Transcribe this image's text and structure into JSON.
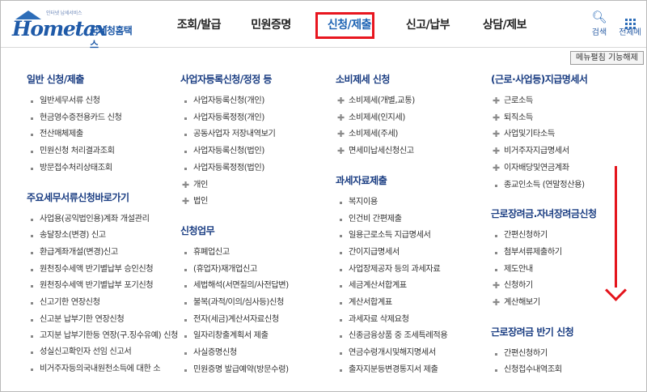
{
  "header": {
    "logo_tagline": "인터넷 납세서비스",
    "logo_word": "Hometax",
    "logo_sub": "국세청홈택스",
    "menu": [
      "조회/발급",
      "민원증명",
      "신청/제출",
      "신고/납부",
      "상담/제보"
    ],
    "active_menu_index": 2,
    "search_label": "검색",
    "all_menu_label": "전체메",
    "highlight_color": "#e8161f",
    "brand_color": "#1f5aa8"
  },
  "pin_button_label": "메뉴펼침 기능해제",
  "columns": [
    {
      "sections": [
        {
          "title": "일반 신청/제출",
          "items": [
            {
              "label": "일반세무서류 신청",
              "marker": "dot"
            },
            {
              "label": "현금영수증전용카드 신청",
              "marker": "dot"
            },
            {
              "label": "전산매체제출",
              "marker": "dot"
            },
            {
              "label": "민원신청 처리결과조회",
              "marker": "dot"
            },
            {
              "label": "방문접수처리상태조회",
              "marker": "dot"
            }
          ]
        },
        {
          "title": "주요세무서류신청바로가기",
          "items": [
            {
              "label": "사업용(공익법인용)계좌 개설관리",
              "marker": "dot"
            },
            {
              "label": "송달장소(변경) 신고",
              "marker": "dot"
            },
            {
              "label": "환급계좌개설(변경)신고",
              "marker": "dot"
            },
            {
              "label": "원천징수세액 반기별납부 승인신청",
              "marker": "dot"
            },
            {
              "label": "원천징수세액 반기별납부 포기신청",
              "marker": "dot"
            },
            {
              "label": "신고기한 연장신청",
              "marker": "dot"
            },
            {
              "label": "신고분 납부기한 연장신청",
              "marker": "dot"
            },
            {
              "label": "고지분 납부기한등 연장(구.징수유예) 신청",
              "marker": "dot",
              "wrap": true
            },
            {
              "label": "성실신고확인자 선임 신고서",
              "marker": "dot"
            },
            {
              "label": "비거주자등의국내원천소득에 대한 소",
              "marker": "dot"
            }
          ]
        }
      ]
    },
    {
      "sections": [
        {
          "title": "사업자등록신청/정정 등",
          "items": [
            {
              "label": "사업자등록신청(개인)",
              "marker": "dot"
            },
            {
              "label": "사업자등록정정(개인)",
              "marker": "dot"
            },
            {
              "label": "공동사업자 저장내역보기",
              "marker": "dot"
            },
            {
              "label": "사업자등록신청(법인)",
              "marker": "dot"
            },
            {
              "label": "사업자등록정정(법인)",
              "marker": "dot"
            },
            {
              "label": "개인",
              "marker": "plus"
            },
            {
              "label": "법인",
              "marker": "plus"
            }
          ]
        },
        {
          "title": "신청업무",
          "items": [
            {
              "label": "휴폐업신고",
              "marker": "dot"
            },
            {
              "label": "(휴업자)재개업신고",
              "marker": "dot"
            },
            {
              "label": "세법해석(서면질의/사전답변)",
              "marker": "dot"
            },
            {
              "label": "불복(과적/이의/심사등)신청",
              "marker": "dot"
            },
            {
              "label": "전자(세금)계산서자료신청",
              "marker": "dot"
            },
            {
              "label": "일자리창출계획서 제출",
              "marker": "dot"
            },
            {
              "label": "사실증명신청",
              "marker": "dot"
            },
            {
              "label": "민원증명 발급예약(방문수령)",
              "marker": "dot"
            }
          ]
        }
      ]
    },
    {
      "sections": [
        {
          "title": "소비제세 신청",
          "items": [
            {
              "label": "소비제세(개별,교통)",
              "marker": "plus"
            },
            {
              "label": "소비제세(인지세)",
              "marker": "plus"
            },
            {
              "label": "소비제세(주세)",
              "marker": "plus"
            },
            {
              "label": "면세미납세신청신고",
              "marker": "plus"
            }
          ]
        },
        {
          "title": "과세자료제출",
          "items": [
            {
              "label": "복지이용",
              "marker": "dot"
            },
            {
              "label": "인건비 간편제출",
              "marker": "dot"
            },
            {
              "label": "일용근로소득 지급명세서",
              "marker": "dot"
            },
            {
              "label": "간이지급명세서",
              "marker": "dot"
            },
            {
              "label": "사업장제공자 등의 과세자료",
              "marker": "dot"
            },
            {
              "label": "세금계산서합계표",
              "marker": "dot"
            },
            {
              "label": "계산서합계표",
              "marker": "dot"
            },
            {
              "label": "과세자료 삭제요청",
              "marker": "dot"
            },
            {
              "label": "신종금융상품 중 조세특례적용",
              "marker": "dot"
            },
            {
              "label": "연금수령개시및해지명세서",
              "marker": "dot"
            },
            {
              "label": "출자지분등변경통지서 제출",
              "marker": "dot"
            }
          ]
        }
      ]
    },
    {
      "sections": [
        {
          "title": "(근로·사업등)지급명세서",
          "items": [
            {
              "label": "근로소득",
              "marker": "plus"
            },
            {
              "label": "퇴직소득",
              "marker": "plus"
            },
            {
              "label": "사업및기타소득",
              "marker": "plus"
            },
            {
              "label": "비거주자지급명세서",
              "marker": "plus"
            },
            {
              "label": "이자배당및연금계좌",
              "marker": "plus"
            },
            {
              "label": "종교인소득 (연말정산용)",
              "marker": "dot"
            }
          ]
        },
        {
          "title": "근로장려금.자녀장려금신청",
          "items": [
            {
              "label": "간편신청하기",
              "marker": "dot"
            },
            {
              "label": "첨부서류제출하기",
              "marker": "dot"
            },
            {
              "label": "제도안내",
              "marker": "dot"
            },
            {
              "label": "신청하기",
              "marker": "plus"
            },
            {
              "label": "계산해보기",
              "marker": "plus"
            }
          ]
        },
        {
          "title": "근로장려금 반기 신청",
          "items": [
            {
              "label": "간편신청하기",
              "marker": "dot"
            },
            {
              "label": "신청접수내역조회",
              "marker": "dot"
            }
          ]
        }
      ]
    }
  ],
  "annotation_arrow_color": "#e4141c"
}
